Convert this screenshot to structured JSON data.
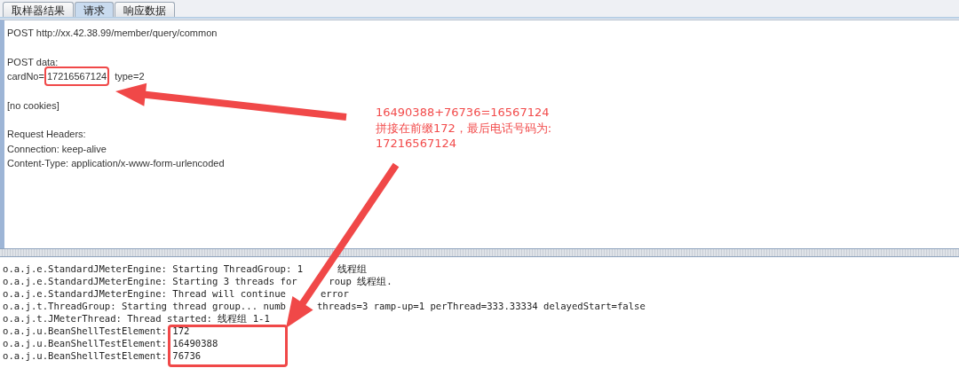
{
  "tabs": [
    {
      "label": "取样器结果",
      "selected": false
    },
    {
      "label": "请求",
      "selected": true
    },
    {
      "label": "响应数据",
      "selected": false
    }
  ],
  "request_blocks": [
    [
      {
        "parts": [
          {
            "text": "POST http://xx.42.38.99/member/query/common",
            "highlighted": false
          }
        ]
      }
    ],
    [
      {
        "parts": [
          {
            "text": "POST data:",
            "highlighted": false
          }
        ]
      },
      {
        "parts": [
          {
            "text": "cardNo=",
            "highlighted": false
          },
          {
            "text": "17216567124",
            "highlighted": true
          },
          {
            "text": "type=2",
            "highlighted": false
          }
        ]
      }
    ],
    [
      {
        "parts": [
          {
            "text": "[no cookies]",
            "highlighted": false
          }
        ]
      }
    ],
    [
      {
        "parts": [
          {
            "text": "Request Headers:",
            "highlighted": false
          }
        ]
      },
      {
        "parts": [
          {
            "text": "Connection: keep-alive",
            "highlighted": false
          }
        ]
      },
      {
        "parts": [
          {
            "text": "Content-Type: application/x-www-form-urlencoded",
            "highlighted": false
          }
        ]
      }
    ]
  ],
  "log_lines": [
    [
      "o.a.j.e.StandardJMeterEngine: Starting ThreadGroup: 1",
      "线程组"
    ],
    [
      "o.a.j.e.StandardJMeterEngine: Starting 3 threads for",
      "roup 线程组."
    ],
    [
      "o.a.j.e.StandardJMeterEngine: Thread will continue",
      "error"
    ],
    [
      "o.a.j.t.ThreadGroup: Starting thread group... numb",
      "threads=3 ramp-up=1 perThread=333.33334 delayedStart=false"
    ],
    [
      "o.a.j.t.JMeterThread: Thread started: 线程组 1-1"
    ],
    [
      "o.a.j.u.BeanShellTestElement: 172"
    ],
    [
      "o.a.j.u.BeanShellTestElement: 16490388"
    ],
    [
      "o.a.j.u.BeanShellTestElement: 76736"
    ]
  ],
  "annotation": {
    "lines": [
      "16490388+76736=16567124",
      "拼接在前缀172，最后电话号码为:",
      "17216567124"
    ]
  }
}
